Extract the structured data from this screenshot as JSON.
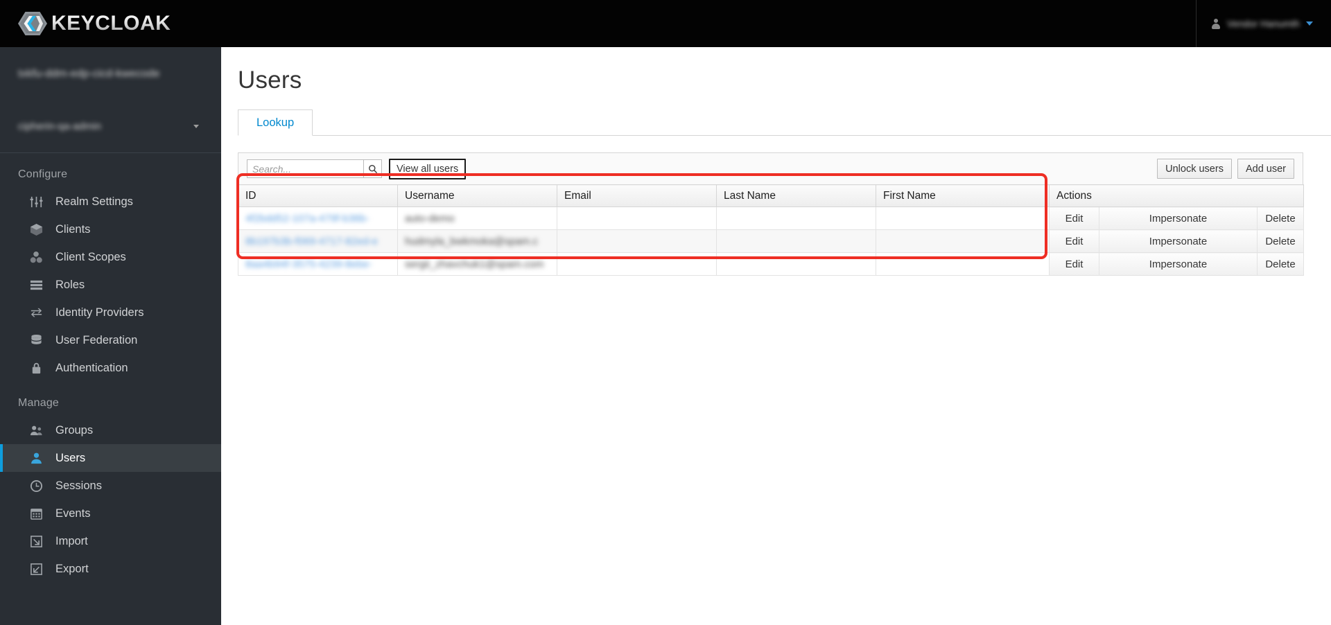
{
  "masthead": {
    "brand_name": "KEYCLOAK",
    "brand_icon": "keycloak-hexagon-logo",
    "user_icon": "user-icon",
    "user_label": "Vendor Hanumth",
    "caret_icon": "chevron-down-icon"
  },
  "sidebar": {
    "realm_name": "txkfu-ddm-edp-cicd-kwecode",
    "realm_user": "cipherin-qa-admin",
    "realm_caret_icon": "caret-down-icon",
    "groups": [
      {
        "title": "Configure",
        "items": [
          {
            "label": "Realm Settings",
            "icon": "sliders-icon",
            "active": false
          },
          {
            "label": "Clients",
            "icon": "cube-icon",
            "active": false
          },
          {
            "label": "Client Scopes",
            "icon": "cubes-icon",
            "active": false
          },
          {
            "label": "Roles",
            "icon": "list-icon",
            "active": false
          },
          {
            "label": "Identity Providers",
            "icon": "exchange-arrows-icon",
            "active": false
          },
          {
            "label": "User Federation",
            "icon": "database-icon",
            "active": false
          },
          {
            "label": "Authentication",
            "icon": "lock-icon",
            "active": false
          }
        ]
      },
      {
        "title": "Manage",
        "items": [
          {
            "label": "Groups",
            "icon": "users-group-icon",
            "active": false
          },
          {
            "label": "Users",
            "icon": "user-icon",
            "active": true
          },
          {
            "label": "Sessions",
            "icon": "clock-icon",
            "active": false
          },
          {
            "label": "Events",
            "icon": "calendar-icon",
            "active": false
          },
          {
            "label": "Import",
            "icon": "arrow-into-box-icon",
            "active": false
          },
          {
            "label": "Export",
            "icon": "arrow-out-of-box-icon",
            "active": false
          }
        ]
      }
    ]
  },
  "main": {
    "page_title": "Users",
    "tabs": [
      {
        "label": "Lookup",
        "active": true
      }
    ],
    "toolbar": {
      "search_placeholder": "Search...",
      "search_value": "",
      "search_icon": "magnifier-icon",
      "view_all_label": "View all users",
      "unlock_users_label": "Unlock users",
      "add_user_label": "Add user"
    },
    "table": {
      "columns": [
        "ID",
        "Username",
        "Email",
        "Last Name",
        "First Name",
        "Actions"
      ],
      "rows": [
        {
          "id": "4f2bdd52-107a-479f-b36b-",
          "username": "auto-demo",
          "email": "",
          "last_name": "",
          "first_name": "",
          "actions": [
            "Edit",
            "Impersonate",
            "Delete"
          ]
        },
        {
          "id": "8b197b3b-f069-4717-82ed-e",
          "username": "hudmyla_bwkmoka@spam.c",
          "email": "",
          "last_name": "",
          "first_name": "",
          "actions": [
            "Edit",
            "Impersonate",
            "Delete"
          ]
        },
        {
          "id": "8aa4b94f-3575-4239-8ebe-",
          "username": "sergii_zhavchuk1@spam.com",
          "email": "",
          "last_name": "",
          "first_name": "",
          "actions": [
            "Edit",
            "Impersonate",
            "Delete"
          ]
        }
      ]
    }
  },
  "annotation": {
    "name": "red-highlight-box",
    "color": "#ee2e24"
  },
  "colors": {
    "masthead_bg": "#030303",
    "sidebar_bg": "#292e34",
    "sidebar_active_bg": "#393f44",
    "accent_blue": "#0088ce",
    "active_border": "#0e9ddd",
    "annotation_red": "#ee2e24"
  }
}
